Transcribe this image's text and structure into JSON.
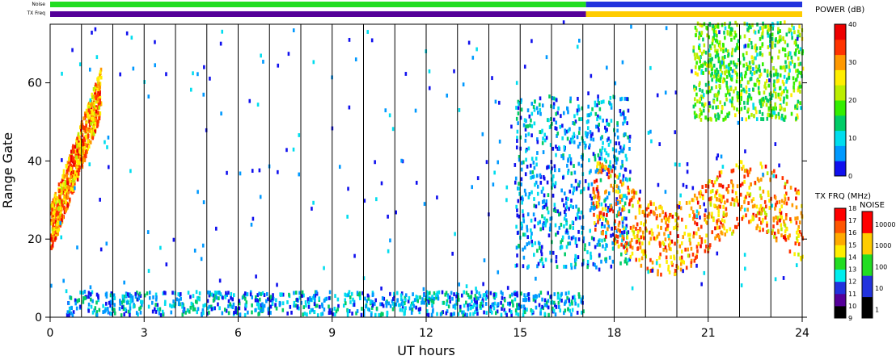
{
  "chart_data": {
    "type": "heatmap",
    "title": "",
    "xlabel": "UT hours",
    "ylabel": "Range Gate",
    "xlim": [
      0,
      24
    ],
    "ylim": [
      0,
      75
    ],
    "xticks": [
      "0",
      "3",
      "6",
      "9",
      "12",
      "15",
      "18",
      "21",
      "24"
    ],
    "yticks": [
      "0",
      "20",
      "40",
      "60"
    ],
    "grid": "vertical lines every UT hour",
    "status_bars": {
      "noise_label": "Noise",
      "txfreq_label": "TX Freq",
      "noise_segments": [
        {
          "from": 0,
          "to": 17.1,
          "level": "100",
          "color": "#22dd22"
        },
        {
          "from": 17.1,
          "to": 24,
          "level": "10",
          "color": "#2233dd"
        }
      ],
      "txfreq_segments": [
        {
          "from": 0,
          "to": 17.1,
          "mhz": 10,
          "color": "#550099"
        },
        {
          "from": 17.1,
          "to": 24,
          "mhz": 14,
          "color": "#ffcc00"
        }
      ]
    },
    "power_colorbar": {
      "label": "POWER (dB)",
      "ticks": [
        "0",
        "10",
        "20",
        "30",
        "40"
      ],
      "range": [
        0,
        40
      ],
      "colors": [
        "#1010ee",
        "#0099ff",
        "#00ddee",
        "#00cc66",
        "#33ee00",
        "#bbee00",
        "#ffee00",
        "#ff9900",
        "#ff3300",
        "#ee0000"
      ]
    },
    "txfreq_colorbar": {
      "label": "TX FRQ (MHz)",
      "ticks": [
        "9",
        "10",
        "11",
        "12",
        "13",
        "14",
        "15",
        "16",
        "17",
        "18"
      ],
      "colors": [
        "#000000",
        "#550099",
        "#2233dd",
        "#00eeee",
        "#22dd22",
        "#ffee00",
        "#ffaa00",
        "#ff5500",
        "#ff0000"
      ]
    },
    "noise_colorbar": {
      "label": "NOISE",
      "ticks": [
        "1",
        "10",
        "100",
        "1000",
        "10000"
      ],
      "colors": [
        "#000000",
        "#2233dd",
        "#22dd22",
        "#ffcc00",
        "#ff0000"
      ]
    },
    "features": [
      {
        "name": "near-range clutter",
        "t_from": 0.5,
        "t_to": 17,
        "gate_from": 0,
        "gate_to": 6,
        "power_db": 8
      },
      {
        "name": "early E-region echo",
        "t_from": 0,
        "t_to": 1.6,
        "gate_from": 19,
        "gate_to": 72,
        "power_db": 30
      },
      {
        "name": "afternoon scatter",
        "t_from": 14.8,
        "t_to": 18.5,
        "gate_from": 12,
        "gate_to": 56,
        "power_db": 8
      },
      {
        "name": "evening F-region band",
        "t_from": 17.3,
        "t_to": 24,
        "gate_from": 18,
        "gate_to": 45,
        "power_db": 30
      },
      {
        "name": "evening high-range echo",
        "t_from": 20.5,
        "t_to": 24,
        "gate_from": 50,
        "gate_to": 75,
        "power_db": 18
      },
      {
        "name": "random scatter",
        "t_from": 0,
        "t_to": 24,
        "gate_from": 6,
        "gate_to": 75,
        "power_db": 5
      }
    ]
  }
}
